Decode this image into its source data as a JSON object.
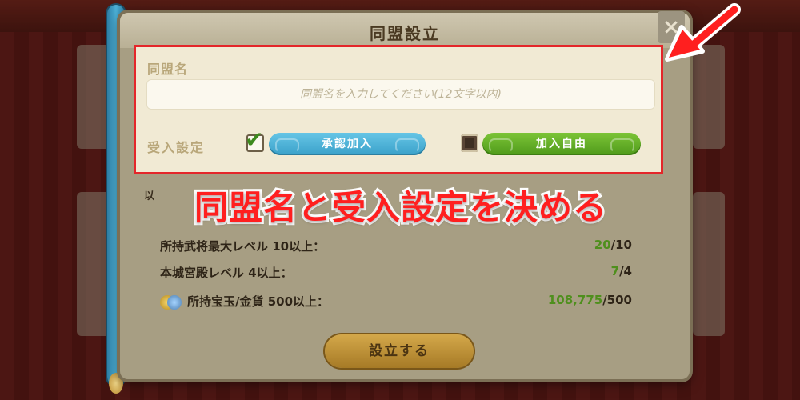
{
  "modal": {
    "title": "同盟設立",
    "close_label": "×"
  },
  "form": {
    "name_label": "同盟名",
    "name_placeholder": "同盟名を入力してください(12文字以内)",
    "accept_label": "受入設定",
    "option_approval": {
      "label": "承認加入",
      "checked": true
    },
    "option_free": {
      "label": "加入自由",
      "checked": false
    }
  },
  "requirements": {
    "partial_header": "以",
    "items": [
      {
        "label": "所持武将最大レベル 10以上：",
        "current": "20",
        "required": "/10"
      },
      {
        "label": "本城宮殿レベル 4以上：",
        "current": "7",
        "required": "/4"
      },
      {
        "label": "所持宝玉/金貨 500以上：",
        "current": "108,775",
        "required": "/500",
        "icon": "coin-gem-icon"
      }
    ]
  },
  "found_button": "設立する",
  "annotation": {
    "caption": "同盟名と受入設定を決める"
  },
  "colors": {
    "highlight": "#e4262a",
    "approval_pill": "#3aa1c9",
    "free_pill": "#4f9a1a",
    "value_green": "#4f8f1d"
  }
}
